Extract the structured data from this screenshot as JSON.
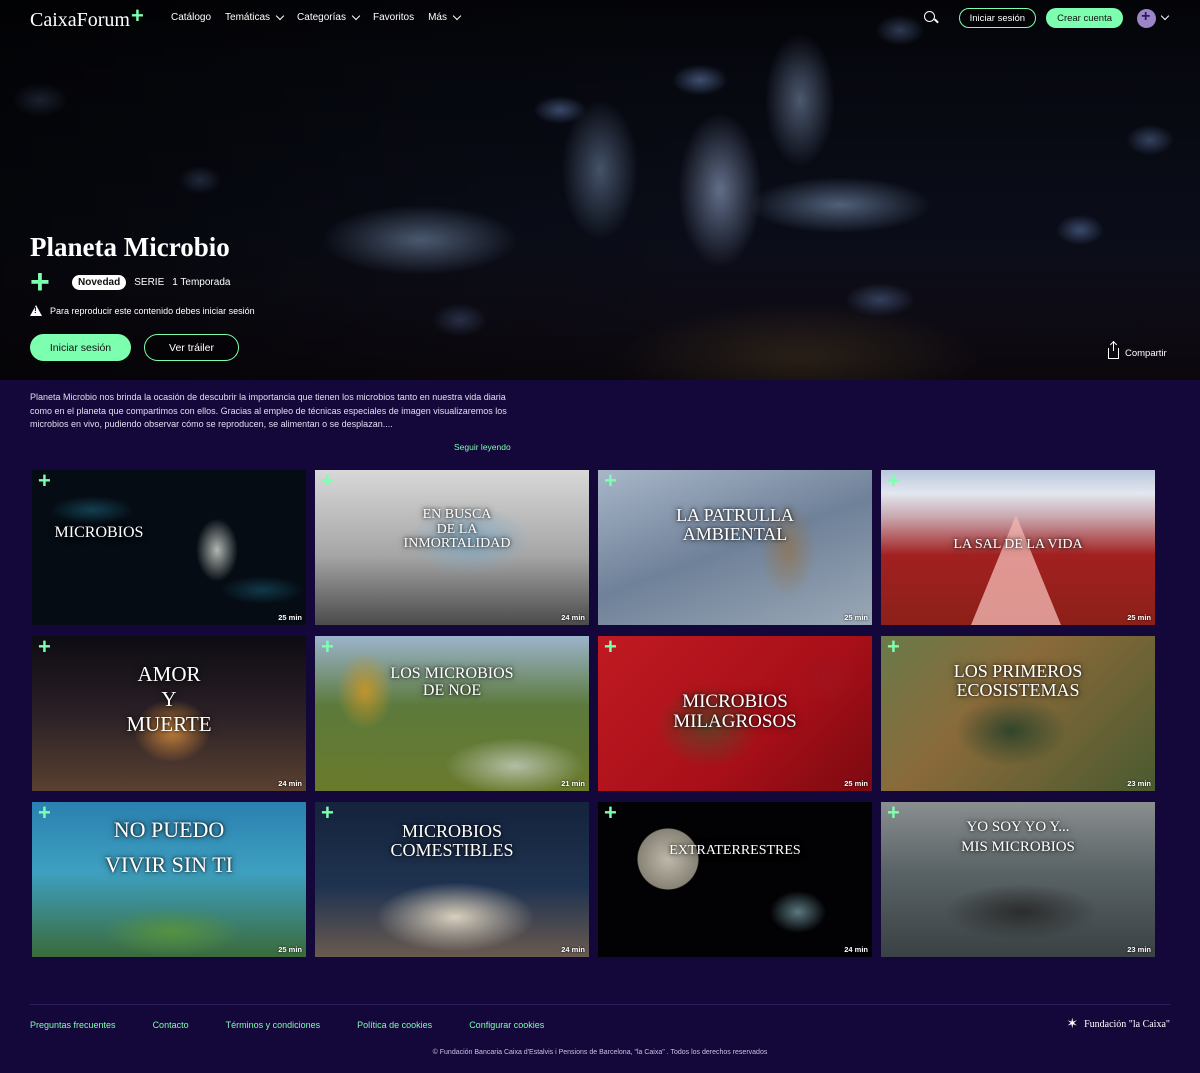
{
  "nav": {
    "logo": "CaixaForum",
    "logo_plus": "+",
    "links": [
      {
        "label": "Catálogo",
        "dropdown": false
      },
      {
        "label": "Temáticas",
        "dropdown": true
      },
      {
        "label": "Categorías",
        "dropdown": true
      },
      {
        "label": "Favoritos",
        "dropdown": false
      },
      {
        "label": "Más",
        "dropdown": true
      }
    ],
    "login_label": "Iniciar sesión",
    "signup_label": "Crear cuenta",
    "icons": [
      "search-icon",
      "avatar",
      "chevron-down-icon"
    ]
  },
  "hero": {
    "title": "Planeta Microbio",
    "badge": "Novedad",
    "type": "SERIE",
    "seasons": "1 Temporada",
    "warning": "Para reproducir este contenido debes iniciar sesión",
    "login_button": "Iniciar sesión",
    "trailer_button": "Ver tráiler",
    "share_label": "Compartir"
  },
  "description": {
    "text": "Planeta Microbio nos brinda la ocasión de descubrir la importancia que tienen los microbios tanto en nuestra vida diaria como en el planeta que compartimos con ellos. Gracias al empleo de técnicas especiales de imagen visualizaremos los microbios en vivo, pudiendo observar cómo se reproducen, se alimentan o se desplazan....",
    "read_more": "Seguir leyendo"
  },
  "episodes": [
    {
      "title": "MICROBIOS",
      "duration": "25 min"
    },
    {
      "title": "EN BUSCA\nDE LA\nINMORTALIDAD",
      "duration": "24 min"
    },
    {
      "title": "LA PATRULLA\nAMBIENTAL",
      "duration": "25 min"
    },
    {
      "title": "LA SAL DE LA VIDA",
      "duration": "25 min"
    },
    {
      "title": "AMOR\nY\nMUERTE",
      "duration": "24 min"
    },
    {
      "title": "LOS MICROBIOS\nDE NOE",
      "duration": "21 min"
    },
    {
      "title": "MICROBIOS\nMILAGROSOS",
      "duration": "25 min"
    },
    {
      "title": "LOS PRIMEROS\nECOSISTEMAS",
      "duration": "23 min"
    },
    {
      "title": "NO PUEDO\nVIVIR SIN TI",
      "duration": "25 min"
    },
    {
      "title": "MICROBIOS\nCOMESTIBLES",
      "duration": "24 min"
    },
    {
      "title": "EXTRATERRESTRES",
      "duration": "24 min"
    },
    {
      "title": "YO SOY YO Y...\nMIS MICROBIOS",
      "duration": "23 min"
    }
  ],
  "footer": {
    "links": [
      "Preguntas frecuentes",
      "Contacto",
      "Términos y condiciones",
      "Política de cookies",
      "Configurar cookies"
    ],
    "brand": "Fundación \"la Caixa\"",
    "copyright": "© Fundación Bancaria Caixa d'Estalvis i Pensions de Barcelona, \"la Caixa\" . Todos los derechos reservados"
  },
  "colors": {
    "accent": "#7dffb0",
    "background": "#14083a"
  }
}
